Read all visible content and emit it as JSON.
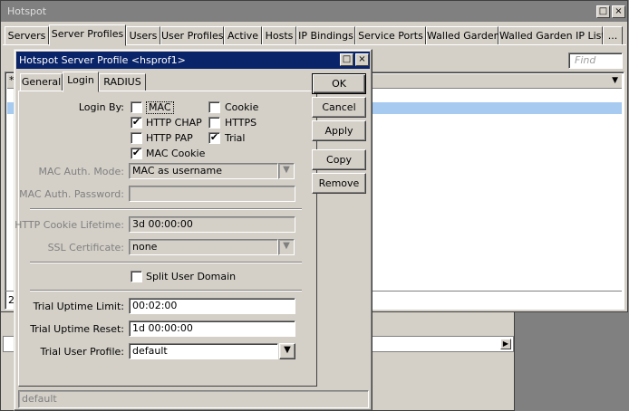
{
  "hotspot": {
    "title": "Hotspot",
    "tabs": [
      "Servers",
      "Server Profiles",
      "Users",
      "User Profiles",
      "Active",
      "Hosts",
      "IP Bindings",
      "Service Ports",
      "Walled Garden",
      "Walled Garden IP List",
      "..."
    ],
    "active_tab": "Server Profiles",
    "find_placeholder": "Find",
    "list_header_first": "*",
    "item_count": "2"
  },
  "dialog": {
    "title": "Hotspot Server Profile <hsprof1>",
    "tabs": [
      "General",
      "Login",
      "RADIUS"
    ],
    "active_tab": "Login",
    "login_by_label": "Login By:",
    "login_methods": [
      {
        "label": "MAC",
        "checked": false
      },
      {
        "label": "Cookie",
        "checked": false
      },
      {
        "label": "HTTP CHAP",
        "checked": true
      },
      {
        "label": "HTTPS",
        "checked": false
      },
      {
        "label": "HTTP PAP",
        "checked": false
      },
      {
        "label": "Trial",
        "checked": true
      },
      {
        "label": "MAC Cookie",
        "checked": true
      }
    ],
    "mac_auth_mode_label": "MAC Auth. Mode:",
    "mac_auth_mode_value": "MAC as username",
    "mac_auth_password_label": "MAC Auth. Password:",
    "mac_auth_password_value": "",
    "cookie_lifetime_label": "HTTP Cookie Lifetime:",
    "cookie_lifetime_value": "3d 00:00:00",
    "ssl_label": "SSL Certificate:",
    "ssl_value": "none",
    "split_domain_label": "Split User Domain",
    "split_domain_checked": false,
    "trial_uptime_limit_label": "Trial Uptime Limit:",
    "trial_uptime_limit_value": "00:02:00",
    "trial_uptime_reset_label": "Trial Uptime Reset:",
    "trial_uptime_reset_value": "1d 00:00:00",
    "trial_user_profile_label": "Trial User Profile:",
    "trial_user_profile_value": "default",
    "buttons": {
      "ok": "OK",
      "cancel": "Cancel",
      "apply": "Apply",
      "copy": "Copy",
      "remove": "Remove"
    },
    "status": "default"
  },
  "icons": {
    "maximize": "maximize-icon",
    "close": "close-icon",
    "dropdown": "dropdown-arrow-icon",
    "scroll_right": "scroll-right-icon"
  }
}
